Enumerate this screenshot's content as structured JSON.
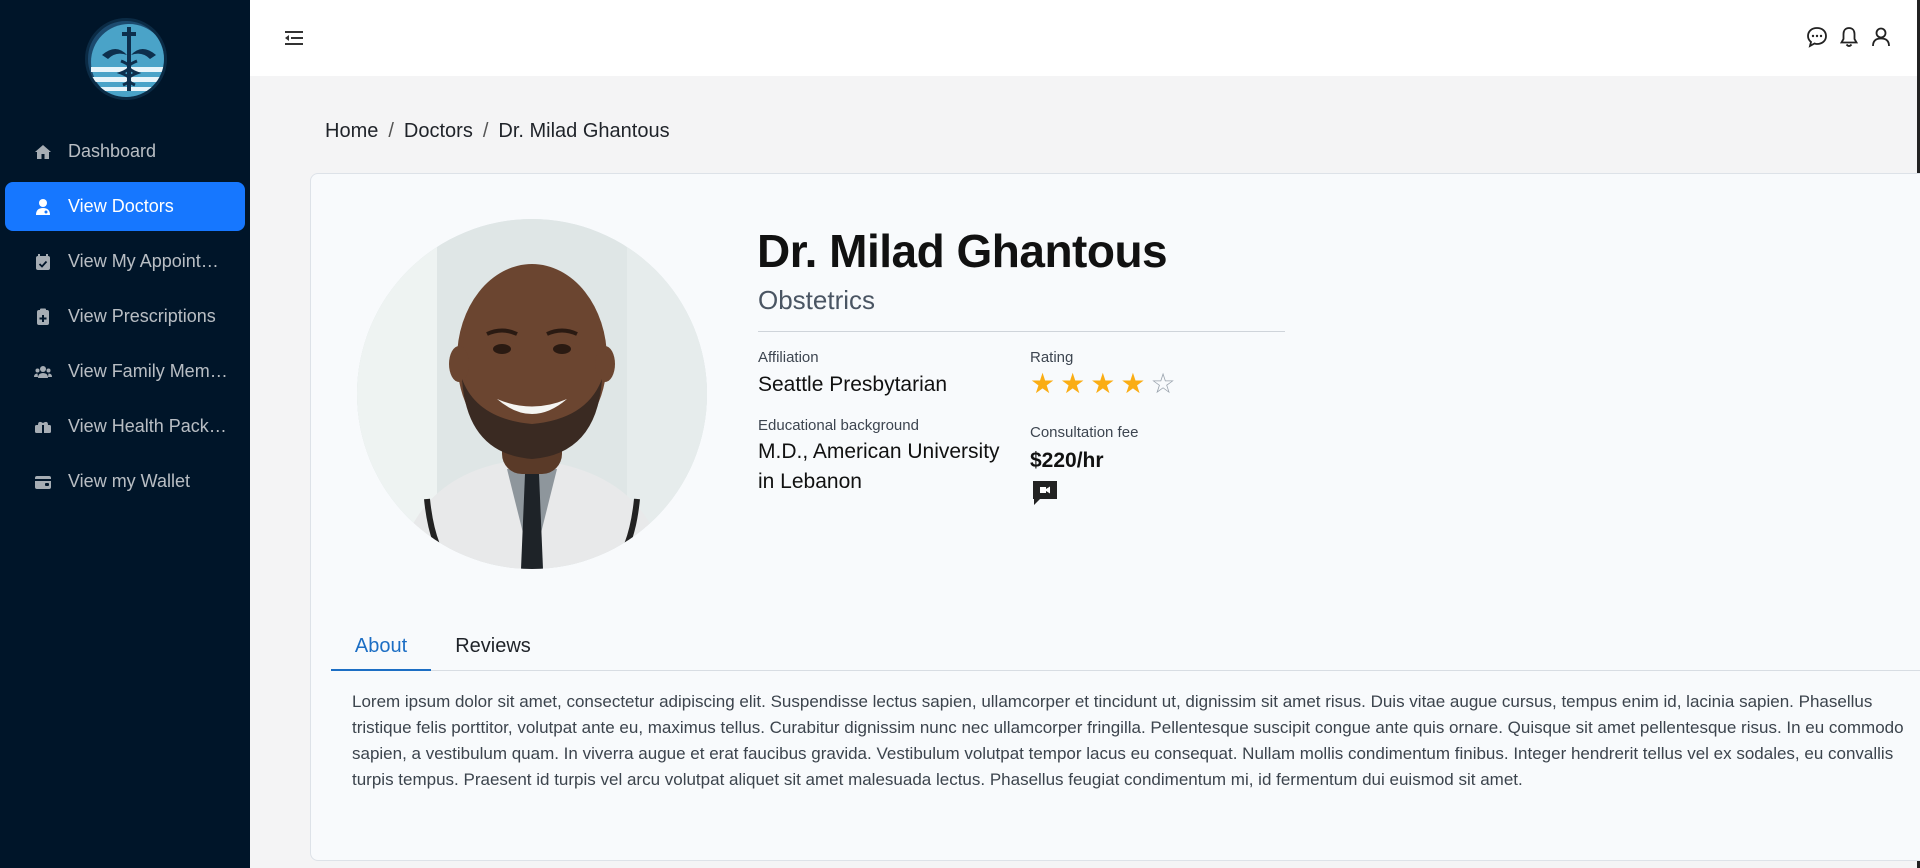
{
  "sidebar": {
    "items": [
      {
        "label": "Dashboard",
        "icon": "home-icon",
        "active": false
      },
      {
        "label": "View Doctors",
        "icon": "doctor-icon",
        "active": true
      },
      {
        "label": "View My Appointments",
        "icon": "calendar-check-icon",
        "active": false
      },
      {
        "label": "View Prescriptions",
        "icon": "prescription-icon",
        "active": false
      },
      {
        "label": "View Family Members",
        "icon": "family-icon",
        "active": false
      },
      {
        "label": "View Health Packages",
        "icon": "package-icon",
        "active": false
      },
      {
        "label": "View my Wallet",
        "icon": "wallet-icon",
        "active": false
      }
    ]
  },
  "header": {
    "icons": [
      "chat-icon",
      "bell-icon",
      "user-icon"
    ]
  },
  "breadcrumb": {
    "home": "Home",
    "doctors": "Doctors",
    "current": "Dr. Milad Ghantous",
    "separator": "/"
  },
  "doctor": {
    "name": "Dr. Milad Ghantous",
    "specialty": "Obstetrics",
    "affiliation_label": "Affiliation",
    "affiliation": "Seattle Presbytarian",
    "education_label": "Educational background",
    "education": "M.D., American University in Lebanon",
    "rating_label": "Rating",
    "rating": 4,
    "rating_max": 5,
    "fee_label": "Consultation fee",
    "fee": "$220/hr"
  },
  "tabs": [
    {
      "label": "About",
      "active": true
    },
    {
      "label": "Reviews",
      "active": false
    }
  ],
  "about": "Lorem ipsum dolor sit amet, consectetur adipiscing elit. Suspendisse lectus sapien, ullamcorper et tincidunt ut, dignissim sit amet risus. Duis vitae augue cursus, tempus enim id, lacinia sapien. Phasellus tristique felis porttitor, volutpat ante eu, maximus tellus. Curabitur dignissim nunc nec ullamcorper fringilla. Pellentesque suscipit congue ante quis ornare. Quisque sit amet pellentesque risus. In eu commodo sapien, a vestibulum quam. In viverra augue et erat faucibus gravida. Vestibulum volutpat tempor lacus eu consequat. Nullam mollis condimentum finibus. Integer hendrerit tellus vel ex sodales, eu convallis turpis tempus. Praesent id turpis vel arcu volutpat aliquet sit amet malesuada lectus. Phasellus feugiat condimentum mi, id fermentum dui euismod sit amet.",
  "colors": {
    "sidebar_bg": "#001529",
    "active_item": "#1677ff",
    "star": "#faad14",
    "tab_active": "#1c6ec4"
  }
}
